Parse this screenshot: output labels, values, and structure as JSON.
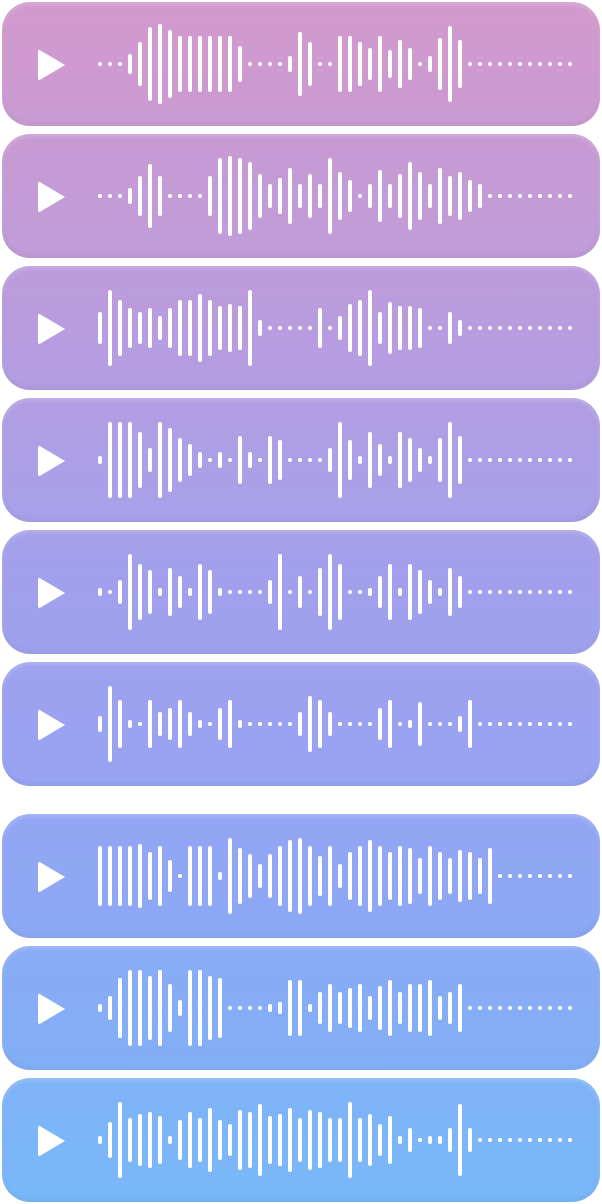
{
  "play_icon": "play-icon",
  "bar_color": "#ffffff",
  "messages": [
    {
      "gradient": [
        "#d399cd",
        "#c99bd2"
      ],
      "waveform": [
        0.05,
        0.05,
        0.05,
        0.25,
        0.55,
        0.92,
        1.0,
        0.85,
        0.7,
        0.7,
        0.7,
        0.7,
        0.7,
        0.7,
        0.45,
        0.05,
        0.05,
        0.05,
        0.05,
        0.2,
        0.8,
        0.55,
        0.05,
        0.05,
        0.7,
        0.7,
        0.55,
        0.4,
        0.7,
        0.35,
        0.6,
        0.4,
        0.05,
        0.2,
        0.65,
        0.95,
        0.6,
        0.05,
        0.05,
        0.05,
        0.05,
        0.05,
        0.05,
        0.05,
        0.05,
        0.05,
        0.05,
        0.05
      ]
    },
    {
      "gradient": [
        "#c89ad3",
        "#bf9cd9"
      ],
      "waveform": [
        0.05,
        0.05,
        0.05,
        0.2,
        0.5,
        0.8,
        0.5,
        0.05,
        0.05,
        0.05,
        0.05,
        0.5,
        0.95,
        1.0,
        0.95,
        0.85,
        0.55,
        0.3,
        0.45,
        0.7,
        0.3,
        0.55,
        0.3,
        0.95,
        0.6,
        0.4,
        0.05,
        0.3,
        0.65,
        0.3,
        0.55,
        0.85,
        0.6,
        0.3,
        0.7,
        0.5,
        0.6,
        0.4,
        0.3,
        0.05,
        0.05,
        0.05,
        0.05,
        0.05,
        0.05,
        0.05,
        0.05,
        0.05
      ]
    },
    {
      "gradient": [
        "#bd9bdb",
        "#b39de2"
      ],
      "waveform": [
        0.4,
        0.95,
        0.7,
        0.5,
        0.4,
        0.5,
        0.3,
        0.5,
        0.7,
        0.7,
        0.85,
        0.7,
        0.55,
        0.6,
        0.55,
        0.95,
        0.2,
        0.05,
        0.05,
        0.05,
        0.05,
        0.05,
        0.5,
        0.05,
        0.3,
        0.6,
        0.7,
        0.95,
        0.4,
        0.65,
        0.55,
        0.55,
        0.5,
        0.05,
        0.05,
        0.4,
        0.2,
        0.05,
        0.05,
        0.05,
        0.05,
        0.05,
        0.05,
        0.05,
        0.05,
        0.05,
        0.05,
        0.05
      ]
    },
    {
      "gradient": [
        "#b19ee3",
        "#a7a0e9"
      ],
      "waveform": [
        0.1,
        0.95,
        0.95,
        0.95,
        0.7,
        0.3,
        0.95,
        0.8,
        0.55,
        0.4,
        0.2,
        0.05,
        0.2,
        0.05,
        0.6,
        0.2,
        0.05,
        0.6,
        0.5,
        0.05,
        0.05,
        0.05,
        0.05,
        0.3,
        0.95,
        0.5,
        0.1,
        0.7,
        0.4,
        0.1,
        0.7,
        0.55,
        0.3,
        0.1,
        0.55,
        0.95,
        0.6,
        0.05,
        0.05,
        0.05,
        0.05,
        0.05,
        0.05,
        0.05,
        0.05,
        0.05,
        0.05,
        0.05
      ]
    },
    {
      "gradient": [
        "#a5a0ea",
        "#9ea1ee"
      ],
      "waveform": [
        0.1,
        0.05,
        0.3,
        0.95,
        0.7,
        0.55,
        0.1,
        0.6,
        0.4,
        0.1,
        0.7,
        0.55,
        0.1,
        0.05,
        0.05,
        0.05,
        0.05,
        0.3,
        0.95,
        0.05,
        0.4,
        0.05,
        0.6,
        0.95,
        0.7,
        0.05,
        0.05,
        0.1,
        0.4,
        0.7,
        0.1,
        0.7,
        0.55,
        0.3,
        0.1,
        0.6,
        0.4,
        0.05,
        0.05,
        0.05,
        0.05,
        0.05,
        0.05,
        0.05,
        0.05,
        0.05,
        0.05,
        0.05
      ]
    },
    {
      "gradient": [
        "#9ea2ef",
        "#97a3f3"
      ],
      "waveform": [
        0.2,
        0.95,
        0.6,
        0.1,
        0.05,
        0.6,
        0.3,
        0.4,
        0.6,
        0.3,
        0.1,
        0.05,
        0.4,
        0.6,
        0.1,
        0.05,
        0.05,
        0.05,
        0.05,
        0.05,
        0.3,
        0.7,
        0.6,
        0.3,
        0.05,
        0.05,
        0.05,
        0.05,
        0.4,
        0.6,
        0.05,
        0.1,
        0.55,
        0.05,
        0.05,
        0.05,
        0.2,
        0.6,
        0.05,
        0.05,
        0.05,
        0.05,
        0.05,
        0.05,
        0.05,
        0.05,
        0.05,
        0.05
      ]
    },
    {
      "gradient": [
        "#93a6f4",
        "#8ca8f5"
      ],
      "waveform": [
        0.75,
        0.75,
        0.75,
        0.75,
        0.8,
        0.6,
        0.75,
        0.4,
        0.05,
        0.75,
        0.75,
        0.75,
        0.1,
        0.95,
        0.7,
        0.55,
        0.3,
        0.55,
        0.75,
        0.9,
        0.95,
        0.75,
        0.5,
        0.75,
        0.3,
        0.6,
        0.75,
        0.9,
        0.75,
        0.6,
        0.75,
        0.7,
        0.45,
        0.75,
        0.6,
        0.45,
        0.65,
        0.6,
        0.45,
        0.7,
        0.05,
        0.05,
        0.05,
        0.05,
        0.05,
        0.05,
        0.05,
        0.05
      ]
    },
    {
      "gradient": [
        "#89abf5",
        "#82aff6"
      ],
      "waveform": [
        0.1,
        0.3,
        0.75,
        0.95,
        0.95,
        0.8,
        0.95,
        0.6,
        0.2,
        0.95,
        0.95,
        0.8,
        0.75,
        0.05,
        0.05,
        0.05,
        0.05,
        0.1,
        0.15,
        0.7,
        0.7,
        0.1,
        0.4,
        0.6,
        0.4,
        0.5,
        0.6,
        0.3,
        0.55,
        0.7,
        0.4,
        0.6,
        0.6,
        0.7,
        0.3,
        0.4,
        0.6,
        0.05,
        0.05,
        0.05,
        0.05,
        0.05,
        0.05,
        0.05,
        0.05,
        0.05,
        0.05,
        0.05
      ]
    },
    {
      "gradient": [
        "#7fb3f7",
        "#78b8f8"
      ],
      "waveform": [
        0.1,
        0.45,
        0.95,
        0.55,
        0.65,
        0.7,
        0.6,
        0.1,
        0.5,
        0.7,
        0.55,
        0.8,
        0.5,
        0.4,
        0.75,
        0.7,
        0.9,
        0.6,
        0.65,
        0.8,
        0.55,
        0.75,
        0.7,
        0.55,
        0.55,
        0.95,
        0.55,
        0.65,
        0.4,
        0.6,
        0.1,
        0.3,
        0.05,
        0.1,
        0.1,
        0.3,
        0.9,
        0.3,
        0.05,
        0.05,
        0.05,
        0.05,
        0.05,
        0.05,
        0.05,
        0.05,
        0.05,
        0.05
      ]
    }
  ]
}
